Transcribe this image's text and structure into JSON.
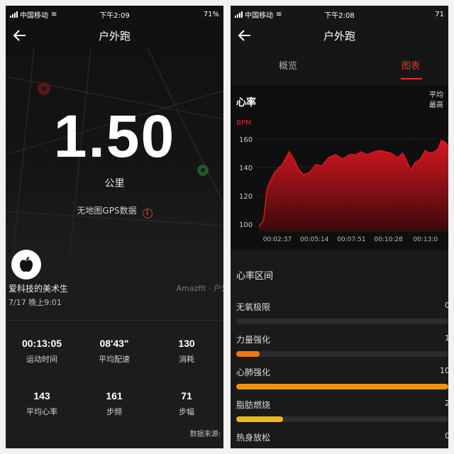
{
  "left": {
    "status": {
      "carrier": "中国移动",
      "time": "下午2:09",
      "battery": "71%"
    },
    "nav": {
      "title": "户外跑"
    },
    "distance": {
      "value": "1.50",
      "unit": "公里"
    },
    "no_gps": {
      "text": "无地图GPS数据",
      "icon": "i"
    },
    "user": {
      "name": "爱科技的美术生",
      "datetime": "7/17 晚上9:01",
      "source_hint": "Amazfit · 户外"
    },
    "stats": [
      {
        "value": "00:13:05",
        "label": "运动时间"
      },
      {
        "value": "08'43\"",
        "label": "平均配速"
      },
      {
        "value": "130",
        "label": "消耗"
      },
      {
        "value": "143",
        "label": "平均心率"
      },
      {
        "value": "161",
        "label": "步频"
      },
      {
        "value": "71",
        "label": "步幅"
      }
    ],
    "data_source_label": "数据来源:"
  },
  "right": {
    "status": {
      "carrier": "中国移动",
      "time": "下午2:08",
      "battery": "71"
    },
    "nav": {
      "title": "户外跑"
    },
    "tabs": {
      "overview": "概览",
      "charts": "图表"
    },
    "heart_rate": {
      "title": "心率",
      "legend_avg": "平均",
      "legend_max": "最高"
    },
    "zones": {
      "title": "心率区间",
      "items": [
        {
          "label": "无氧极限",
          "value": "0",
          "fraction": 0,
          "color": "#2c2c2c"
        },
        {
          "label": "力量强化",
          "value": "1",
          "fraction": 0.11,
          "color": "#f07a10"
        },
        {
          "label": "心肺强化",
          "value": "10",
          "fraction": 1.0,
          "color": "#f0920e"
        },
        {
          "label": "脂肪燃烧",
          "value": "2",
          "fraction": 0.22,
          "color": "#f0b51a"
        },
        {
          "label": "热身放松",
          "value": "0",
          "fraction": 0,
          "color": "#2c2c2c"
        }
      ]
    }
  },
  "chart_data": {
    "type": "area",
    "title": "心率",
    "ylabel": "BPM",
    "ylim": [
      95,
      165
    ],
    "yticks": [
      100,
      120,
      140,
      160
    ],
    "xticks": [
      "00:02:37",
      "00:05:14",
      "00:07:51",
      "00:10:28",
      "00:13:0"
    ],
    "xlim_seconds": [
      0,
      815
    ],
    "series": [
      {
        "color": "#d91820",
        "x": [
          0,
          20,
          35,
          50,
          70,
          100,
          130,
          150,
          170,
          190,
          215,
          245,
          270,
          300,
          330,
          360,
          390,
          420,
          440,
          465,
          495,
          520,
          545,
          570,
          595,
          620,
          640,
          655,
          670,
          695,
          715,
          735,
          755,
          770,
          785,
          800,
          815
        ],
        "y": [
          98,
          103,
          125,
          131,
          137,
          142,
          151,
          146,
          139,
          135,
          136,
          142,
          141,
          147,
          149,
          146,
          149,
          149,
          151,
          149,
          151,
          152,
          151,
          150,
          147,
          150,
          143,
          138,
          143,
          146,
          152,
          150,
          151,
          153,
          159,
          158,
          155
        ]
      }
    ]
  }
}
